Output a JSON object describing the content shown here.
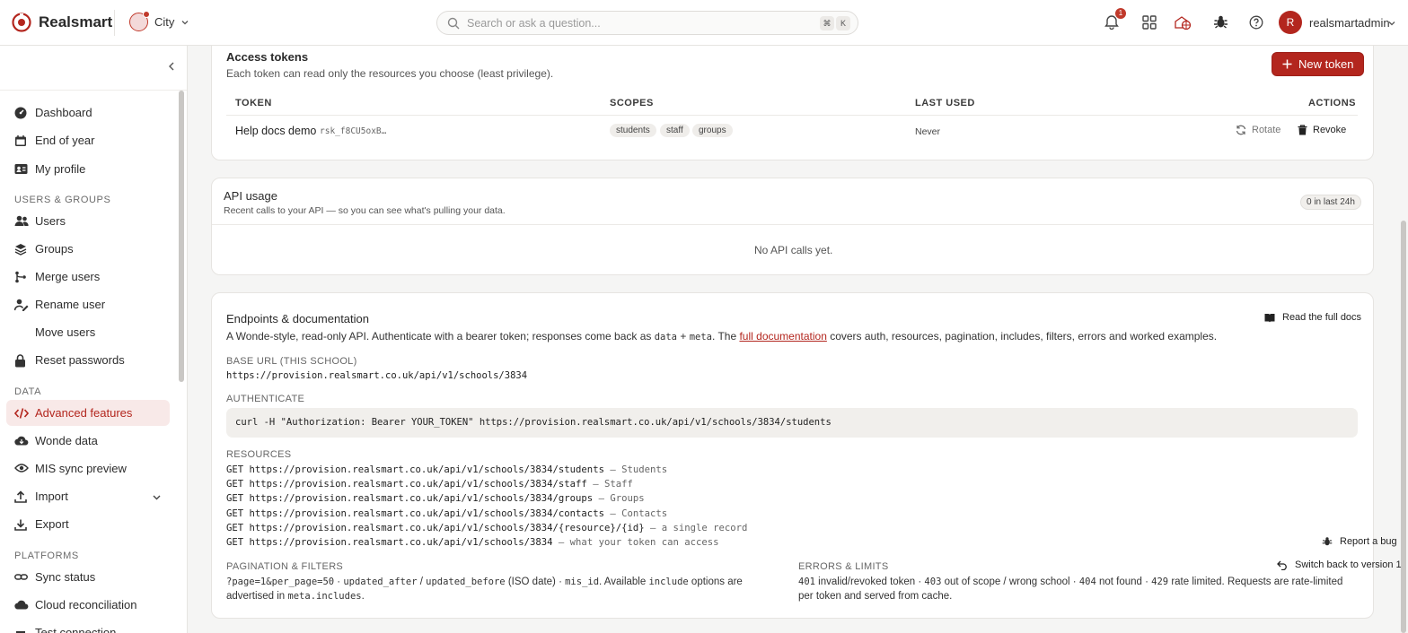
{
  "app": {
    "brand": "Realsmart",
    "school": "City",
    "user_initial": "R",
    "username": "realsmartadmin",
    "notification_count": "1",
    "accent": "#b3261e"
  },
  "search": {
    "placeholder": "Search or ask a question...",
    "kbd1": "⌘",
    "kbd2": "K"
  },
  "sidebar": {
    "items_top": [
      {
        "label": "Dashboard"
      },
      {
        "label": "End of year"
      },
      {
        "label": "My profile"
      }
    ],
    "section_users": "USERS & GROUPS",
    "items_users": [
      {
        "label": "Users"
      },
      {
        "label": "Groups"
      },
      {
        "label": "Merge users"
      },
      {
        "label": "Rename user"
      },
      {
        "label": "Move users"
      },
      {
        "label": "Reset passwords"
      }
    ],
    "section_data": "DATA",
    "items_data": [
      {
        "label": "Advanced features"
      },
      {
        "label": "Wonde data"
      },
      {
        "label": "MIS sync preview"
      },
      {
        "label": "Import"
      },
      {
        "label": "Export"
      }
    ],
    "section_platforms": "PLATFORMS",
    "items_platforms": [
      {
        "label": "Sync status"
      },
      {
        "label": "Cloud reconciliation"
      },
      {
        "label": "Test connection"
      }
    ]
  },
  "tokens": {
    "title": "Access tokens",
    "subtitle": "Each token can read only the resources you choose (least privilege).",
    "new_button": "New token",
    "headers": {
      "token": "TOKEN",
      "scopes": "SCOPES",
      "last_used": "LAST USED",
      "actions": "ACTIONS"
    },
    "rows": [
      {
        "name": "Help docs demo",
        "prefix": "rsk_f8CU5oxB…",
        "scopes": [
          "students",
          "staff",
          "groups"
        ],
        "last_used": "Never",
        "rotate": "Rotate",
        "revoke": "Revoke"
      }
    ]
  },
  "usage": {
    "title": "API usage",
    "subtitle": "Recent calls to your API — so you can see what's pulling your data.",
    "badge": "0 in last 24h",
    "empty": "No API calls yet."
  },
  "docs": {
    "title": "Endpoints & documentation",
    "read_docs": "Read the full docs",
    "intro": {
      "a": "A Wonde-style, read-only API. Authenticate with a bearer token; responses come back as ",
      "code1": "data",
      "plus": " + ",
      "code2": "meta",
      "b": ". The ",
      "link": "full documentation",
      "c": " covers auth, resources, pagination, includes, filters, errors and worked examples."
    },
    "base_label": "BASE URL (THIS SCHOOL)",
    "base_url": "https://provision.realsmart.co.uk/api/v1/schools/3834",
    "auth_label": "AUTHENTICATE",
    "curl": "curl -H \"Authorization: Bearer YOUR_TOKEN\" https://provision.realsmart.co.uk/api/v1/schools/3834/students",
    "resources_label": "RESOURCES",
    "resources": [
      {
        "path": "GET https://provision.realsmart.co.uk/api/v1/schools/3834/students",
        "desc": " — Students"
      },
      {
        "path": "GET https://provision.realsmart.co.uk/api/v1/schools/3834/staff",
        "desc": " — Staff"
      },
      {
        "path": "GET https://provision.realsmart.co.uk/api/v1/schools/3834/groups",
        "desc": " — Groups"
      },
      {
        "path": "GET https://provision.realsmart.co.uk/api/v1/schools/3834/contacts",
        "desc": " — Contacts"
      },
      {
        "path": "GET https://provision.realsmart.co.uk/api/v1/schools/3834/{resource}/{id}",
        "desc": " — a single record"
      },
      {
        "path": "GET https://provision.realsmart.co.uk/api/v1/schools/3834",
        "desc": " — what your token can access"
      }
    ],
    "pagination_label": "PAGINATION & FILTERS",
    "pagination": {
      "c1": "?page=1&per_page=50",
      "t1": " · ",
      "c2": "updated_after",
      "t2": " / ",
      "c3": "updated_before",
      "t3": " (ISO date) · ",
      "c4": "mis_id",
      "t4": ". Available ",
      "c5": "include",
      "t5": " options are advertised in ",
      "c6": "meta.includes",
      "t6": "."
    },
    "errors_label": "ERRORS & LIMITS",
    "errors": {
      "c1": "401",
      "t1": " invalid/revoked token · ",
      "c2": "403",
      "t2": " out of scope / wrong school · ",
      "c3": "404",
      "t3": " not found · ",
      "c4": "429",
      "t4": " rate limited. Requests are rate-limited per token and served from cache."
    }
  },
  "floating": {
    "report_bug": "Report a bug",
    "switch_version": "Switch back to version 1"
  }
}
